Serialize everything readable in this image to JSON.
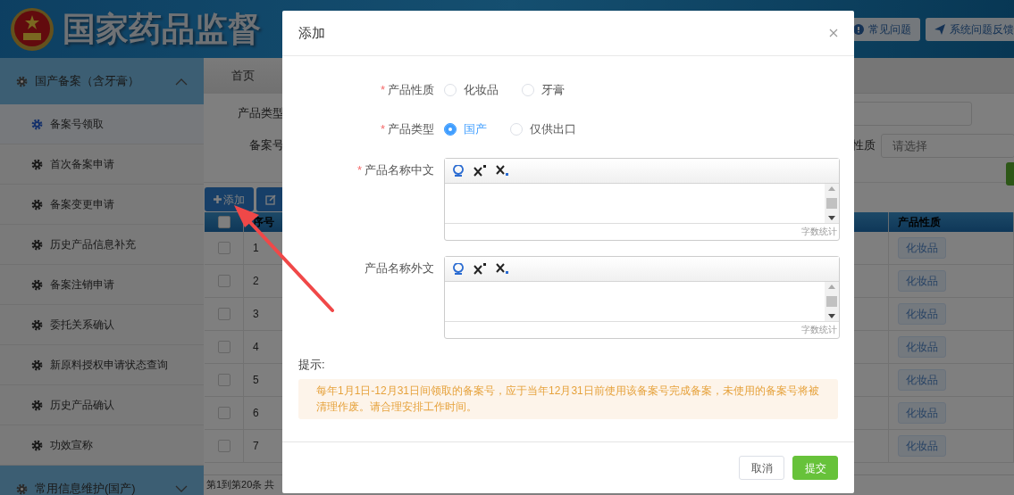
{
  "header": {
    "title": "国家药品监督",
    "buttons": [
      "常见问题",
      "系统问题反馈"
    ]
  },
  "sidebar": {
    "groups": [
      {
        "label": "国产备案（含牙膏）",
        "expanded": true,
        "items": [
          {
            "label": "备案号领取",
            "selected": true
          },
          {
            "label": "首次备案申请",
            "selected": false
          },
          {
            "label": "备案变更申请",
            "selected": false
          },
          {
            "label": "历史产品信息补充",
            "selected": false
          },
          {
            "label": "备案注销申请",
            "selected": false
          },
          {
            "label": "委托关系确认",
            "selected": false
          },
          {
            "label": "新原料授权申请状态查询",
            "selected": false
          },
          {
            "label": "历史产品确认",
            "selected": false
          },
          {
            "label": "功效宣称",
            "selected": false
          }
        ]
      },
      {
        "label": "常用信息维护(国产)",
        "expanded": false
      }
    ]
  },
  "tabs": [
    {
      "label": "首页",
      "selected": true
    }
  ],
  "filters": {
    "labels": [
      "产品类型",
      "备案号"
    ],
    "right_label": "性质",
    "select_placeholder": "请选择"
  },
  "toolbar": {
    "buttons": [
      "添加"
    ]
  },
  "table": {
    "header_checked": false,
    "columns": [
      "序号",
      "产品性质"
    ],
    "rows": [
      {
        "index": "1",
        "nature": "化妆品",
        "checked": false
      },
      {
        "index": "2",
        "nature": "化妆品",
        "checked": false
      },
      {
        "index": "3",
        "nature": "化妆品",
        "checked": false
      },
      {
        "index": "4",
        "nature": "化妆品",
        "checked": false
      },
      {
        "index": "5",
        "nature": "化妆品",
        "checked": false
      },
      {
        "index": "6",
        "nature": "化妆品",
        "checked": false
      },
      {
        "index": "7",
        "nature": "化妆品",
        "checked": false
      }
    ],
    "footer": "第1到第20条 共"
  },
  "dialog": {
    "title": "添加",
    "fields": [
      {
        "kind": "radio",
        "marker": "*",
        "label": "产品性质",
        "options": [
          {
            "label": "化妆品",
            "selected": false
          },
          {
            "label": "牙膏",
            "selected": false
          }
        ]
      },
      {
        "kind": "radio",
        "marker": "*",
        "label": "产品类型",
        "options": [
          {
            "label": "国产",
            "selected": true
          },
          {
            "label": "仅供出口",
            "selected": false
          }
        ]
      },
      {
        "kind": "editor",
        "marker": "*",
        "label": "产品名称中文",
        "counter": "字数统计"
      },
      {
        "kind": "editor",
        "label": "产品名称外文",
        "counter": "字数统计"
      }
    ],
    "tip": {
      "label": "提示:",
      "text": "每年1月1日-12月31日间领取的备案号，应于当年12月31日前使用该备案号完成备案，未使用的备案号将被清理作废。请合理安排工作时间。"
    },
    "buttons": [
      {
        "label": "取消",
        "kind": "default"
      },
      {
        "label": "提交",
        "kind": "primary"
      }
    ]
  }
}
